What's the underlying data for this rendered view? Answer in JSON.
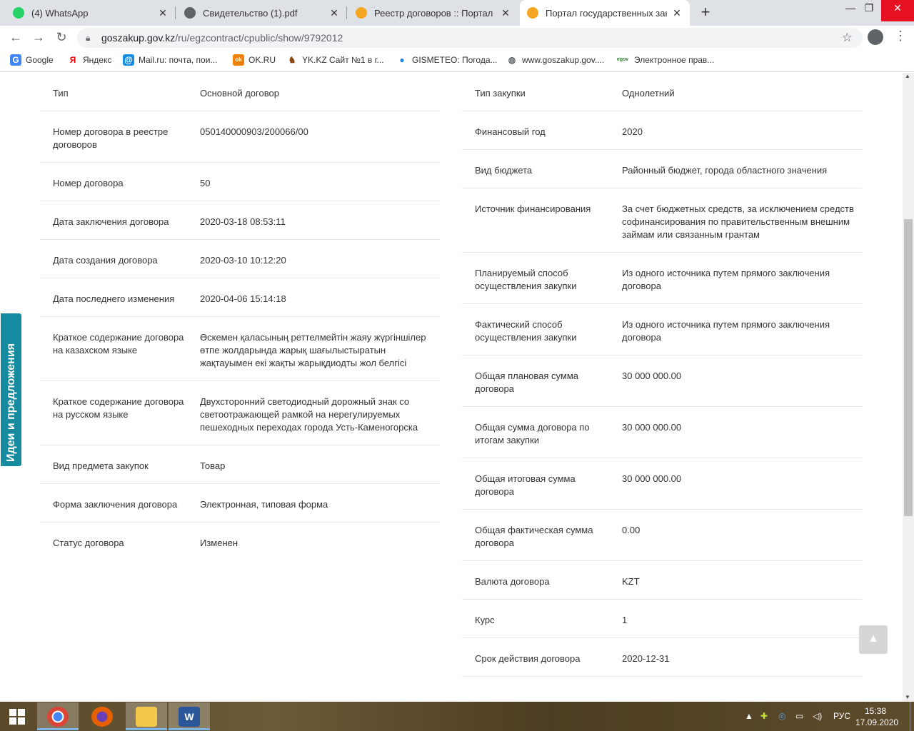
{
  "browser": {
    "tabs": [
      {
        "title": "(4) WhatsApp",
        "favicon_color": "#25d366"
      },
      {
        "title": "Свидетельство (1).pdf",
        "favicon_color": "#5f6368"
      },
      {
        "title": "Реестр договоров :: Портал гос",
        "favicon_color": "#f4a623"
      },
      {
        "title": "Портал государственных закупо",
        "favicon_color": "#f4a623"
      }
    ],
    "new_tab_label": "+",
    "close_glyph": "✕",
    "url_host": "goszakup.gov.kz",
    "url_path": "/ru/egzcontract/cpublic/show/9792012",
    "window_controls": {
      "minimize": "—",
      "maximize": "❐",
      "close": "✕"
    }
  },
  "bookmarks": [
    {
      "label": "Google",
      "icon": "G",
      "color": "#4285f4"
    },
    {
      "label": "Яндекс",
      "icon": "Я",
      "color": "#e00"
    },
    {
      "label": "Mail.ru: почта, пои...",
      "icon": "@",
      "color": "#168de2"
    },
    {
      "label": "OK.RU",
      "icon": "ok",
      "color": "#ee8208"
    },
    {
      "label": "YK.KZ Сайт №1 в г...",
      "icon": "♞",
      "color": "#8b4513"
    },
    {
      "label": "GISMETEO: Погода...",
      "icon": "●",
      "color": "#1e88e5"
    },
    {
      "label": "www.goszakup.gov....",
      "icon": "◍",
      "color": "#5f6368"
    },
    {
      "label": "Электронное прав...",
      "icon": "egov",
      "color": "#2e7d32"
    }
  ],
  "left_rows": [
    {
      "label": "Тип",
      "value": "Основной договор"
    },
    {
      "label": "Номер договора в реестре договоров",
      "value": "050140000903/200066/00"
    },
    {
      "label": "Номер договора",
      "value": "50"
    },
    {
      "label": "Дата заключения договора",
      "value": "2020-03-18 08:53:11"
    },
    {
      "label": "Дата создания договора",
      "value": "2020-03-10 10:12:20"
    },
    {
      "label": "Дата последнего изменения",
      "value": "2020-04-06 15:14:18"
    },
    {
      "label": "Краткое содержание договора на казахском языке",
      "value": "Өскемен қаласының реттелмейтін жаяу жүргіншілер өтпе жолдарында жарық шағылыстыратын жақтауымен екі жақты жарықдиодты жол белгісі"
    },
    {
      "label": "Краткое содержание договора на русском языке",
      "value": "Двухсторонний светодиодный дорожный знак со светоотражающей рамкой на нерегулируемых пешеходных переходах города Усть-Каменогорска"
    },
    {
      "label": "Вид предмета закупок",
      "value": "Товар"
    },
    {
      "label": "Форма заключения договора",
      "value": "Электронная, типовая форма"
    },
    {
      "label": "Статус договора",
      "value": "Изменен"
    }
  ],
  "right_rows": [
    {
      "label": "Тип закупки",
      "value": "Однолетний"
    },
    {
      "label": "Финансовый год",
      "value": "2020"
    },
    {
      "label": "Вид бюджета",
      "value": "Районный бюджет, города областного значения"
    },
    {
      "label": "Источник финансирования",
      "value": "За счет бюджетных средств, за исключением средств софинансирования по правительственным внешним займам или связанным грантам"
    },
    {
      "label": "Планируемый способ осуществления закупки",
      "value": "Из одного источника путем прямого заключения договора"
    },
    {
      "label": "Фактический способ осуществления закупки",
      "value": "Из одного источника путем прямого заключения договора"
    },
    {
      "label": "Общая плановая сумма договора",
      "value": "30 000 000.00"
    },
    {
      "label": "Общая сумма договора по итогам закупки",
      "value": "30 000 000.00"
    },
    {
      "label": "Общая итоговая сумма договора",
      "value": "30 000 000.00"
    },
    {
      "label": "Общая фактическая сумма договора",
      "value": "0.00"
    },
    {
      "label": "Валюта договора",
      "value": "KZT"
    },
    {
      "label": "Курс",
      "value": "1"
    },
    {
      "label": "Срок действия договора",
      "value": "2020-12-31"
    }
  ],
  "feedback_label": "Идеи и предложения",
  "scroll_top_glyph": "▲",
  "taskbar": {
    "apps": [
      {
        "name": "chrome",
        "color": "#4285f4"
      },
      {
        "name": "firefox",
        "color": "#e66000"
      },
      {
        "name": "explorer",
        "color": "#f2c94c"
      },
      {
        "name": "word",
        "color": "#2b579a"
      }
    ],
    "language": "РУС",
    "time": "15:38",
    "date": "17.09.2020"
  }
}
